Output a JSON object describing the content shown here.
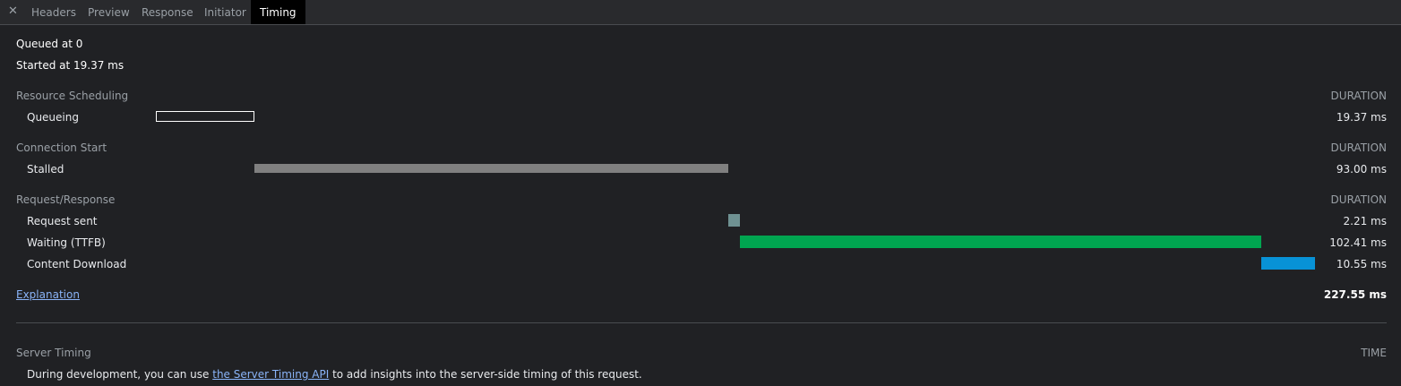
{
  "tabs": {
    "close_glyph": "✕",
    "headers": "Headers",
    "preview": "Preview",
    "response": "Response",
    "initiator": "Initiator",
    "timing": "Timing"
  },
  "info": {
    "queued": "Queued at 0",
    "started": "Started at 19.37 ms"
  },
  "sections": {
    "resource_scheduling": {
      "title": "Resource Scheduling",
      "header": "DURATION"
    },
    "connection_start": {
      "title": "Connection Start",
      "header": "DURATION"
    },
    "request_response": {
      "title": "Request/Response",
      "header": "DURATION"
    },
    "server_timing": {
      "title": "Server Timing",
      "header": "TIME"
    }
  },
  "rows": {
    "queueing": {
      "label": "Queueing",
      "value": "19.37 ms"
    },
    "stalled": {
      "label": "Stalled",
      "value": "93.00 ms"
    },
    "request_sent": {
      "label": "Request sent",
      "value": "2.21 ms"
    },
    "waiting": {
      "label": "Waiting (TTFB)",
      "value": "102.41 ms"
    },
    "content_download": {
      "label": "Content Download",
      "value": "10.55 ms"
    }
  },
  "timing_ms": {
    "total": 227.55,
    "queueing": 19.37,
    "stalled": 93.0,
    "request_sent": 2.21,
    "waiting": 102.41,
    "content_download": 10.55
  },
  "colors": {
    "queueing_border": "#ffffff",
    "stalled": "#808080",
    "request_sent": "#6f9192",
    "waiting": "#00a550",
    "content_download": "#0892d6"
  },
  "explanation": "Explanation",
  "total_label": "227.55 ms",
  "server_timing_text": {
    "before": "During development, you can use ",
    "link": "the Server Timing API",
    "after": " to add insights into the server-side timing of this request."
  }
}
